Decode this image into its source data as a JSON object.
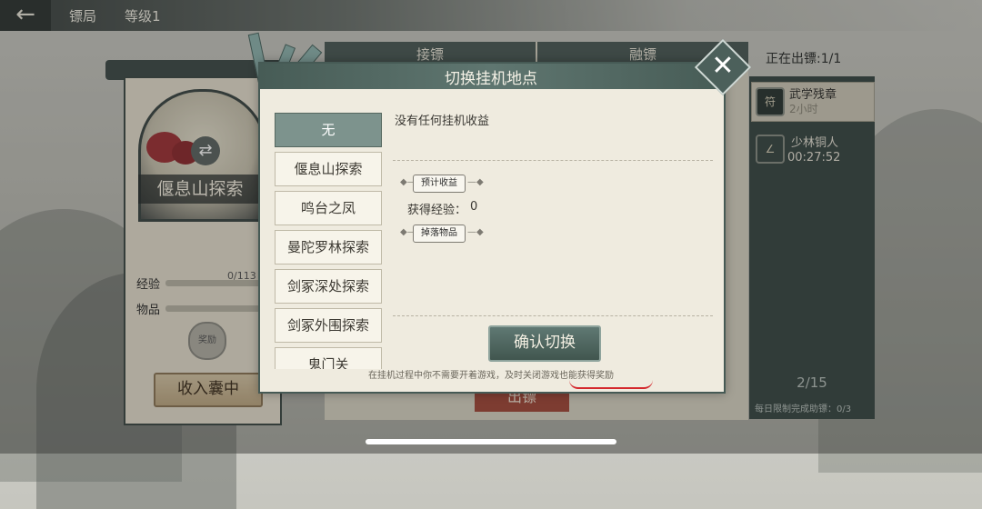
{
  "topbar": {
    "back_glyph": "←",
    "title": "镖局",
    "level": "等级1"
  },
  "left_panel": {
    "place_name": "偃息山探索",
    "swap_glyph": "⇄",
    "exp_label": "经验",
    "exp_value": "0/113",
    "exp_progress": 0,
    "item_label": "物品",
    "bag_icon_text": "奖励",
    "collect_button": "收入囊中"
  },
  "bg_tabs": [
    "接镖",
    "融镖"
  ],
  "bg_send_button": "出镖",
  "right_panel": {
    "status": "正在出镖:1/1",
    "slots": [
      {
        "name": "武学残章",
        "time": "2小时",
        "icon_glyph": "符"
      },
      {
        "name": "少林铜人",
        "time": "00:27:52",
        "icon_glyph": "∠"
      }
    ],
    "count": "2/15",
    "daily_limit": "每日限制完成助镖：0/3"
  },
  "dialog": {
    "title": "切换挂机地点",
    "close_glyph": "✕",
    "locations": [
      "无",
      "偃息山探索",
      "鸣台之凤",
      "曼陀罗林探索",
      "剑冢深处探索",
      "剑冢外围探索",
      "鬼门关"
    ],
    "selected_index": 0,
    "no_income_text": "没有任何挂机收益",
    "expected_income_tag": "预计收益",
    "exp_label": "获得经验：",
    "exp_value": "0",
    "drops_tag": "掉落物品",
    "confirm_button": "确认切换",
    "footer_note": "在挂机过程中你不需要开着游戏，及时关闭游戏也能获得奖励"
  },
  "colors": {
    "accent": "#4c605b",
    "highlight_underline": "#d4282d",
    "send_button": "#a3483a"
  }
}
